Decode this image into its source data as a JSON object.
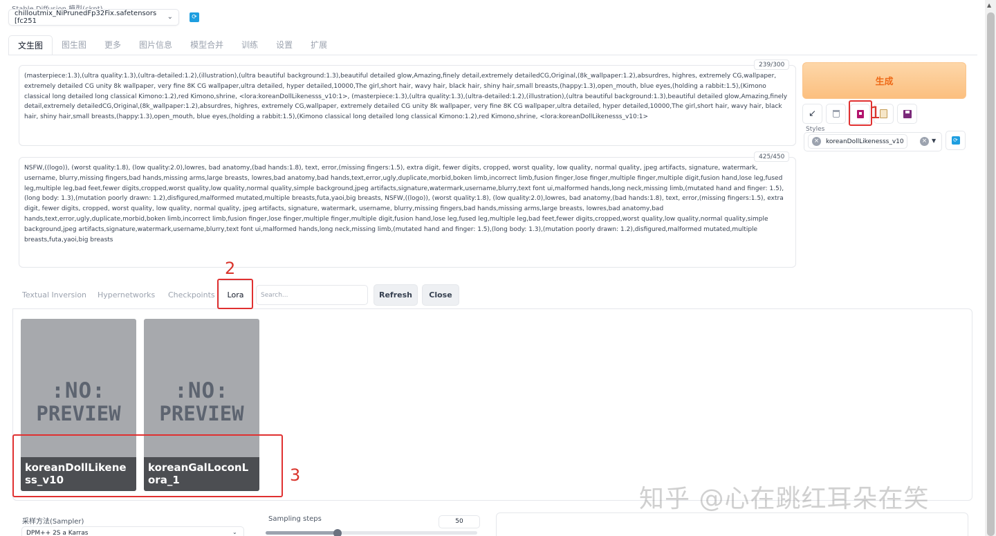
{
  "model": {
    "label": "Stable Diffusion 模型(ckpt)",
    "value": "chilloutmix_NiPrunedFp32Fix.safetensors [fc251"
  },
  "tabs": [
    "文生图",
    "图生图",
    "更多",
    "图片信息",
    "模型合并",
    "训练",
    "设置",
    "扩展"
  ],
  "prompt": {
    "text": "(masterpiece:1.3),(ultra quality:1.3),(ultra-detailed:1.2),(illustration),(ultra beautiful background:1.3),beautiful detailed glow,Amazing,finely detail,extremely detailedCG,Original,(8k_wallpaper:1.2),absurdres, highres, extremely CG,wallpaper, extremely detailed CG unity 8k wallpaper, very fine 8K CG wallpaper,ultra detailed, hyper detailed,10000,The girl,short hair, wavy hair, black hair, shiny hair,small breasts,(happy:1.3),open_mouth, blue eyes,(holding a rabbit:1.5),(Kimono classical long detailed long classical Kimono:1.2),red Kimono,shrine, <lora:koreanDollLikenesss_v10:1>, (masterpiece:1.3),(ultra quality:1.3),(ultra-detailed:1.2),(illustration),(ultra beautiful background:1.3),beautiful detailed glow,Amazing,finely detail,extremely detailedCG,Original,(8k_wallpaper:1.2),absurdres, highres, extremely CG,wallpaper, extremely detailed CG unity 8k wallpaper, very fine 8K CG wallpaper,ultra detailed, hyper detailed,10000,The girl,short hair, wavy hair, black hair, shiny hair,small breasts,(happy:1.3),open_mouth, blue eyes,(holding a rabbit:1.5),(Kimono classical long detailed long classical Kimono:1.2),red Kimono,shrine, <lora:koreanDollLikenesss_v10:1>",
    "counter": "239/300"
  },
  "negative": {
    "text": "NSFW,((logo)), (worst quality:1.8), (low quality:2.0),lowres, bad anatomy,(bad hands:1.8), text, error,(missing fingers:1.5), extra digit, fewer digits, cropped, worst quality, low quality, normal quality, jpeg artifacts, signature, watermark, username, blurry,missing fingers,bad hands,missing arms,large breasts, lowres,bad anatomy,bad hands,text,error,ugly,duplicate,morbid,boken limb,incorrect limb,fusion finger,lose finger,multiple finger,multiple digit,fusion hand,lose leg,fused leg,multiple leg,bad feet,fewer digits,cropped,worst quality,low quality,normal quality,simple background,jpeg artifacts,signature,watermark,username,blurry,text font ui,malformed hands,long neck,missing limb,(mutated hand and finger: 1.5),(long body: 1.3),(mutation poorly drawn: 1.2),disfigured,malformed mutated,multiple breasts,futa,yaoi,big breasts, NSFW,((logo)), (worst quality:1.8), (low quality:2.0),lowres, bad anatomy,(bad hands:1.8), text, error,(missing fingers:1.5), extra digit, fewer digits, cropped, worst quality, low quality, normal quality, jpeg artifacts, signature, watermark, username, blurry,missing fingers,bad hands,missing arms,large breasts, lowres,bad anatomy,bad hands,text,error,ugly,duplicate,morbid,boken limb,incorrect limb,fusion finger,lose finger,multiple finger,multiple digit,fusion hand,lose leg,fused leg,multiple leg,bad feet,fewer digits,cropped,worst quality,low quality,normal quality,simple background,jpeg artifacts,signature,watermark,username,blurry,text font ui,malformed hands,long neck,missing limb,(mutated hand and finger: 1.5),(long body: 1.3),(mutation poorly drawn: 1.2),disfigured,malformed mutated,multiple breasts,futa,yaoi,big breasts",
    "counter": "425/450"
  },
  "generate_label": "生成",
  "tool_icons": [
    "arrow-down-left-icon",
    "trash-icon",
    "show-extra-networks-icon",
    "clipboard-icon",
    "save-style-icon"
  ],
  "styles": {
    "label": "Styles",
    "chip": "koreanDollLikenesss_v10"
  },
  "networks": {
    "tabs": [
      "Textual Inversion",
      "Hypernetworks",
      "Checkpoints",
      "Lora"
    ],
    "active_tab": "Lora",
    "search_placeholder": "Search...",
    "refresh_label": "Refresh",
    "close_label": "Close",
    "no_preview_line1": ":NO:",
    "no_preview_line2": "PREVIEW",
    "cards": [
      {
        "name": "koreanDollLikeness_v10"
      },
      {
        "name": "koreanGalLoconLora_1"
      }
    ]
  },
  "sampler": {
    "label": "采样方法(Sampler)",
    "value": "DPM++ 2S a Karras"
  },
  "steps": {
    "label": "Sampling steps",
    "value": "50",
    "fraction": 0.34
  },
  "annotations": [
    "1",
    "2",
    "3"
  ],
  "watermark": "知乎 @心在跳红耳朵在笑",
  "colors": {
    "generate_text": "#ee6b19",
    "annotation_red": "#e03030",
    "accent_blue": "#1e9ee0"
  }
}
